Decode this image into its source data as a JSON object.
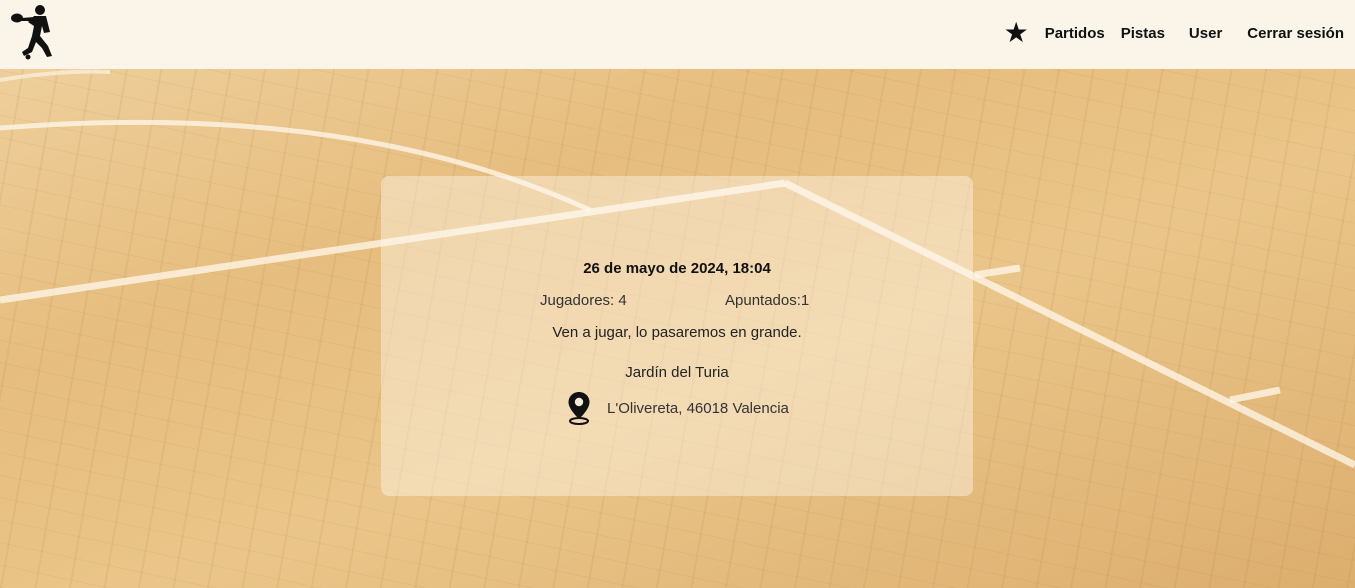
{
  "header": {
    "nav": {
      "favorites_icon": "star-icon",
      "favorites_glyph": "★",
      "partidos": "Partidos",
      "pistas": "Pistas",
      "user": "User",
      "logout": "Cerrar sesión"
    }
  },
  "match": {
    "datetime": "26 de mayo de 2024, 18:04",
    "players_label": "Jugadores: 4",
    "signed_up_label": "Apuntados:1",
    "description": "Ven a jugar, lo pasaremos en grande.",
    "venue": "Jardín del Turia",
    "address": "L'Olivereta, 46018 Valencia",
    "address_icon": "map-pin-icon"
  },
  "colors": {
    "header_bg": "#faf4e9",
    "text": "#111111"
  }
}
